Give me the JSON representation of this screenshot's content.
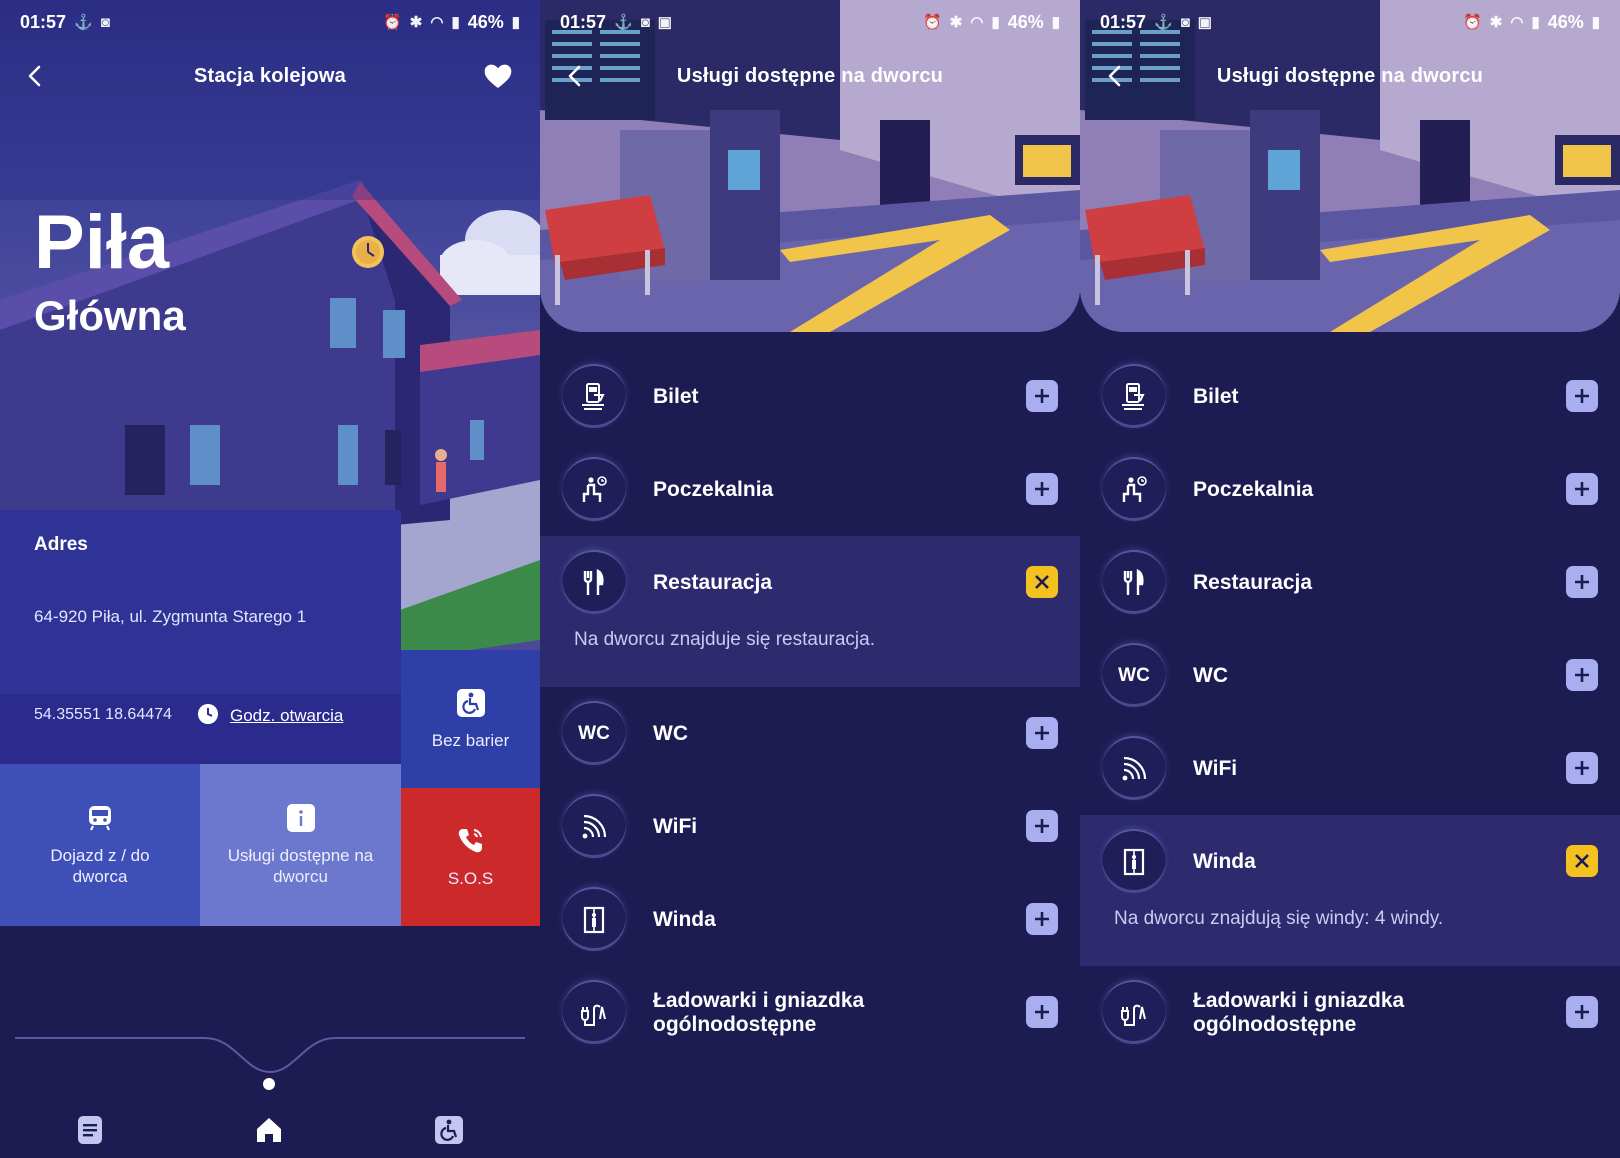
{
  "status": {
    "time": "01:57",
    "battery": "46%"
  },
  "screen1": {
    "title": "Stacja kolejowa",
    "city": "Piła",
    "station": "Główna",
    "address_label": "Adres",
    "address": "64-920 Piła, ul. Zygmunta Starego 1",
    "coords": "54.35551 18.64474",
    "hours_link": "Godz. otwarcia",
    "tiles": {
      "barrier_free": "Bez barier",
      "travel": "Dojazd z / do dworca",
      "services": "Usługi dostępne na dworcu",
      "sos": "S.O.S"
    }
  },
  "services_title": "Usługi dostępne na dworcu",
  "services": {
    "ticket": "Bilet",
    "waiting_room": "Poczekalnia",
    "restaurant": "Restauracja",
    "wc": "WC",
    "wifi": "WiFi",
    "elevator": "Winda",
    "chargers": "Ładowarki i gniazdka ogólnodostępne"
  },
  "wc_icon_text": "WC",
  "descriptions": {
    "restaurant": "Na dworcu znajduje się restauracja.",
    "elevator": "Na dworcu znajdują się windy: 4 windy."
  },
  "colors": {
    "background": "#1d1c52",
    "sos": "#cc2a2a",
    "close_toggle": "#f4c21e",
    "open_toggle": "#a9aef0"
  },
  "icons": [
    "back-arrow-icon",
    "heart-icon",
    "clock-icon",
    "wheelchair-icon",
    "train-icon",
    "info-icon",
    "phone-icon",
    "document-icon",
    "home-icon",
    "plus-icon",
    "close-icon",
    "ticket-machine-icon",
    "waiting-icon",
    "fork-knife-icon",
    "wifi-icon",
    "elevator-icon",
    "plug-icon"
  ]
}
